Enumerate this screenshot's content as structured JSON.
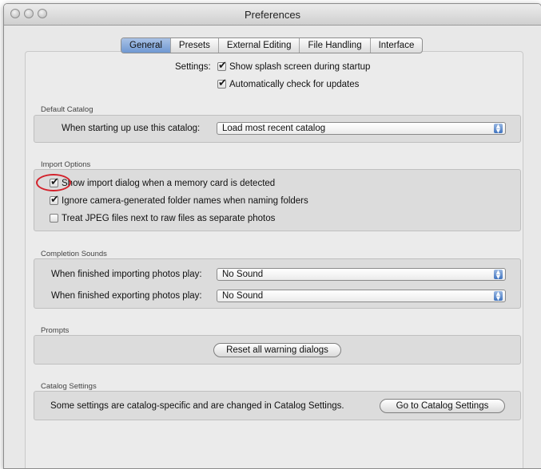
{
  "window": {
    "title": "Preferences"
  },
  "tabs": [
    {
      "label": "General",
      "selected": true
    },
    {
      "label": "Presets",
      "selected": false
    },
    {
      "label": "External Editing",
      "selected": false
    },
    {
      "label": "File Handling",
      "selected": false
    },
    {
      "label": "Interface",
      "selected": false
    }
  ],
  "settings": {
    "label": "Settings:",
    "splash": {
      "label": "Show splash screen during startup",
      "checked": true
    },
    "updates": {
      "label": "Automatically check for updates",
      "checked": true
    }
  },
  "default_catalog": {
    "title": "Default Catalog",
    "label": "When starting up use this catalog:",
    "value": "Load most recent catalog"
  },
  "import_options": {
    "title": "Import Options",
    "show_import": {
      "label": "Show import dialog when a memory card is detected",
      "checked": true
    },
    "ignore_names": {
      "label": "Ignore camera-generated folder names when naming folders",
      "checked": true
    },
    "treat_jpeg": {
      "label": "Treat JPEG files next to raw files as separate photos",
      "checked": false
    }
  },
  "completion_sounds": {
    "title": "Completion Sounds",
    "importing": {
      "label": "When finished importing photos play:",
      "value": "No Sound"
    },
    "exporting": {
      "label": "When finished exporting photos play:",
      "value": "No Sound"
    }
  },
  "prompts": {
    "title": "Prompts",
    "reset_label": "Reset all warning dialogs"
  },
  "catalog_settings": {
    "title": "Catalog Settings",
    "note": "Some settings are catalog-specific and are changed in Catalog Settings.",
    "button_label": "Go to Catalog Settings"
  },
  "colors": {
    "highlight_circle": "#d3212b",
    "tab_selected": "#6f98d2"
  }
}
